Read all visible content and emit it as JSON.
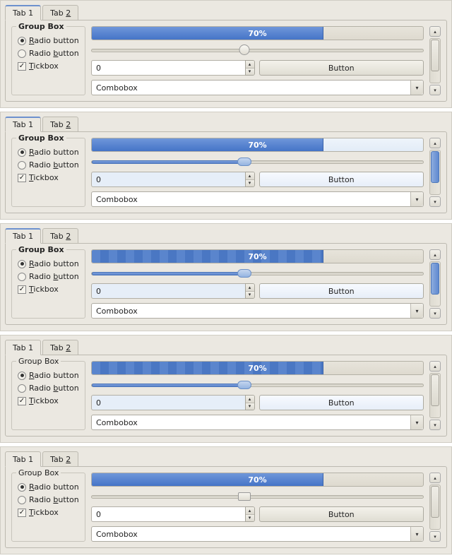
{
  "tabs": {
    "tab1": "Tab 1",
    "tab2": "Tab 2",
    "tab2_u": "2"
  },
  "group": {
    "title": "Group Box",
    "radio1": "Radio button",
    "radio1_u": "R",
    "radio2": "Radio button",
    "radio2_u": "b",
    "tick": "Tickbox",
    "tick_u": "T"
  },
  "controls": {
    "progress_pct": 70,
    "progress_label": "70%",
    "slider_pct": 46,
    "spin_value": "0",
    "button_label": "Button",
    "combo_value": "Combobox",
    "up": "▴",
    "down": "▾",
    "drop": "▾"
  },
  "themes": [
    {
      "id": "clearlooks",
      "progress": "plain",
      "slider_thumb": "round",
      "slider_fill": false,
      "spin_blue": false,
      "btn_light": false,
      "scroll_blue": false,
      "tab_highlight": true
    },
    {
      "id": "glossy",
      "progress": "light",
      "slider_thumb": "oval",
      "slider_fill": true,
      "spin_blue": true,
      "btn_light": true,
      "scroll_blue": true,
      "tab_highlight": true
    },
    {
      "id": "striped1",
      "progress": "striped",
      "slider_thumb": "oval",
      "slider_fill": true,
      "spin_blue": true,
      "btn_light": true,
      "scroll_blue": true,
      "tab_highlight": true
    },
    {
      "id": "striped2",
      "progress": "striped",
      "slider_thumb": "oval",
      "slider_fill": true,
      "spin_blue": true,
      "btn_light": true,
      "scroll_blue": true,
      "tab_highlight": false
    },
    {
      "id": "classic",
      "progress": "plain",
      "slider_thumb": "rect",
      "slider_fill": false,
      "spin_blue": false,
      "btn_light": false,
      "scroll_blue": false,
      "tab_highlight": false
    }
  ]
}
